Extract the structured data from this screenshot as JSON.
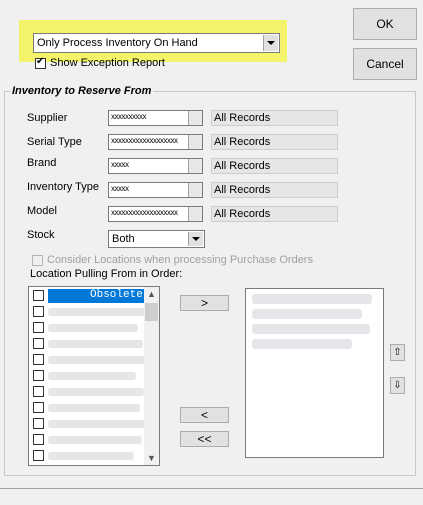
{
  "header": {
    "process_select": "Only Process Inventory On Hand",
    "show_exception_label": "Show Exception Report",
    "ok_label": "OK",
    "cancel_label": "Cancel"
  },
  "group": {
    "title": "Inventory to Reserve From",
    "fields": [
      {
        "label": "Supplier",
        "value": "xxxxxxxxxx",
        "display": "All Records"
      },
      {
        "label": "Serial Type",
        "value": "xxxxxxxxxxxxxxxxxxx",
        "display": "All Records"
      },
      {
        "label": "Brand",
        "value": "xxxxx",
        "display": "All Records"
      },
      {
        "label": "Inventory Type",
        "value": "xxxxx",
        "display": "All Records"
      },
      {
        "label": "Model",
        "value": "xxxxxxxxxxxxxxxxxxx",
        "display": "All Records"
      }
    ],
    "stock_label": "Stock",
    "stock_value": "Both",
    "consider_locations_label": "Consider Locations when processing Purchase Orders",
    "location_order_label": "Location Pulling From in Order:"
  },
  "left_list": {
    "selected_item": "Obsolete"
  },
  "buttons": {
    "add": ">",
    "remove": "<",
    "remove_all": "<<",
    "move_up": "⇧",
    "move_down": "⇩"
  },
  "colors": {
    "highlight": "#f4f46a",
    "selection": "#0078d7",
    "readonly_bg": "#e5e5e5"
  }
}
